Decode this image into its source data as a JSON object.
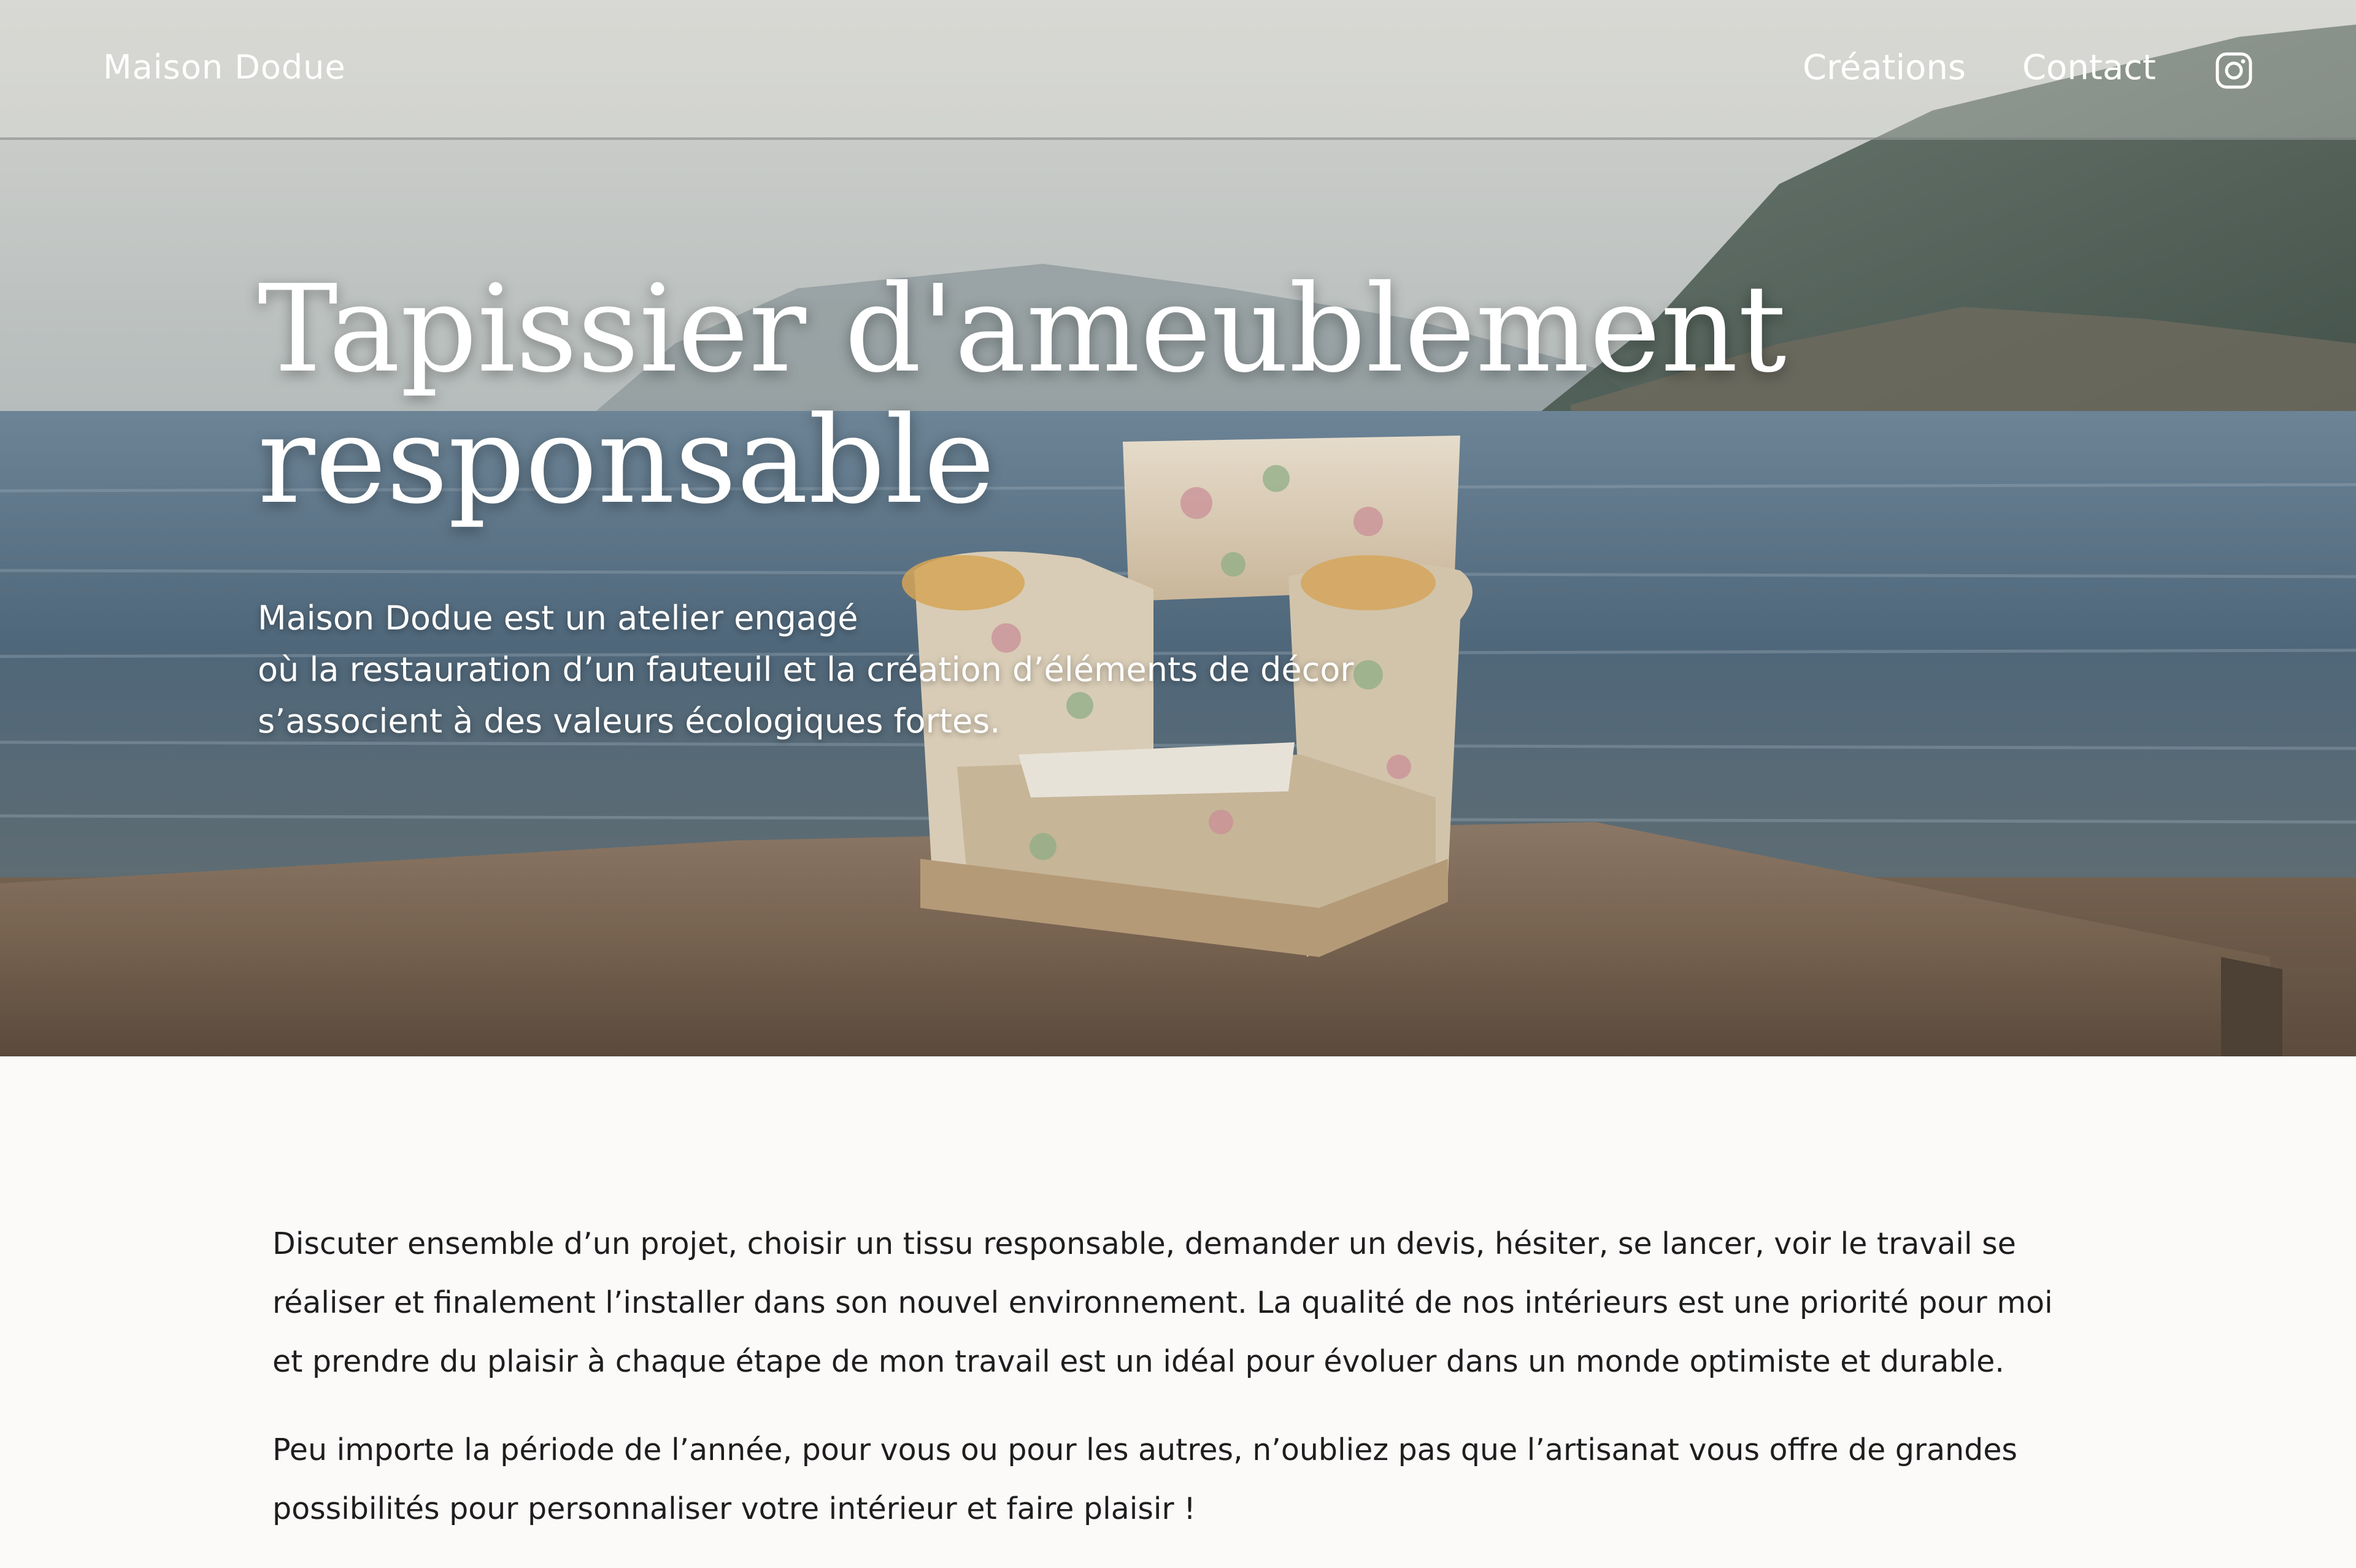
{
  "header": {
    "brand": "Maison Dodue",
    "nav": {
      "creations": "Créations",
      "contact": "Contact"
    },
    "social_icon": "instagram-icon"
  },
  "hero": {
    "title_lines": [
      "Tapissier d'ameublement",
      "responsable"
    ],
    "subtitle_lines": [
      "Maison Dodue est un atelier engagé",
      "où la restauration d’un fauteuil et la création d’éléments de décor",
      "s’associent à des valeurs écologiques fortes."
    ],
    "background_image": "floral-armchair-on-concrete-pier-by-the-sea"
  },
  "main": {
    "paragraphs": [
      "Discuter ensemble d’un projet, choisir un tissu responsable, demander un devis, hésiter, se lancer, voir le travail se réaliser et finalement l’installer dans son nouvel environnement. La qualité de nos intérieurs est une priorité pour moi et prendre du plaisir à chaque étape de mon travail est un idéal pour évoluer dans un monde optimiste et durable.",
      "Peu importe la période de l’année, pour vous ou pour les autres, n’oubliez pas que l’artisanat vous offre de grandes possibilités pour personnaliser votre intérieur et faire plaisir !"
    ]
  },
  "colors": {
    "page_background": "#fcf9f9",
    "text": "#1e1e1e",
    "hero_text": "#ffffff"
  }
}
